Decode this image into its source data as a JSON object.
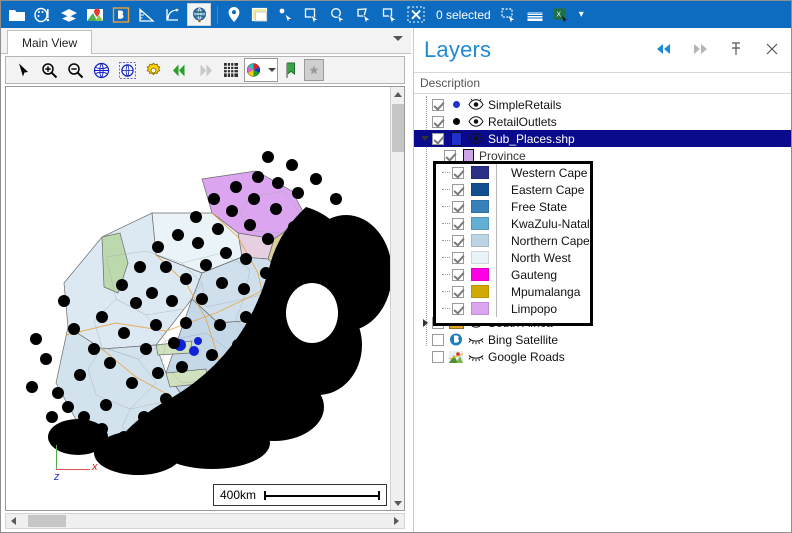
{
  "topbar": {
    "status_text": "0 selected",
    "buttons": [
      {
        "name": "open-folder-icon",
        "label": "Open"
      },
      {
        "name": "symbology-palette-icon",
        "label": "Symbology"
      },
      {
        "name": "layers-stack-icon",
        "label": "Layers"
      },
      {
        "name": "map-pin-image-icon",
        "label": "Add Map"
      },
      {
        "name": "bing-b-icon",
        "label": "Bing"
      },
      {
        "name": "measure-ruler-icon",
        "label": "Measure"
      },
      {
        "name": "coordinate-vector-icon",
        "label": "Coordinates"
      },
      {
        "name": "globe-icon",
        "label": "Globe",
        "active": true
      },
      {
        "name": "location-marker-icon",
        "label": "Identify"
      },
      {
        "name": "map-frame-icon",
        "label": "Map Frame"
      },
      {
        "name": "select-point-icon",
        "label": "Select by Point"
      },
      {
        "name": "select-rectangle-icon",
        "label": "Select by Rectangle"
      },
      {
        "name": "select-circle-icon",
        "label": "Select by Circle"
      },
      {
        "name": "select-polygon-icon",
        "label": "Select by Polygon"
      },
      {
        "name": "select-line-icon",
        "label": "Select by Line"
      },
      {
        "name": "clear-selection-icon",
        "label": "Clear Selection"
      },
      {
        "name": "zoom-to-selection-icon",
        "label": "Zoom to Selection"
      },
      {
        "name": "attribute-table-icon",
        "label": "Attribute Table"
      },
      {
        "name": "export-excel-icon",
        "label": "Export to Excel"
      }
    ],
    "overflow_caret": "▾"
  },
  "tabs": {
    "items": [
      {
        "label": "Main View",
        "active": true
      }
    ],
    "overflow_label": ""
  },
  "map_toolbar": {
    "buttons": [
      {
        "name": "pan-pointer-icon",
        "label": "Pointer"
      },
      {
        "name": "zoom-in-icon",
        "label": "Zoom In"
      },
      {
        "name": "zoom-out-icon",
        "label": "Zoom Out"
      },
      {
        "name": "zoom-full-extent-icon",
        "label": "Full Extent"
      },
      {
        "name": "zoom-layer-extent-icon",
        "label": "Layer Extent"
      },
      {
        "name": "settings-gear-icon",
        "label": "Settings"
      },
      {
        "name": "previous-extent-icon",
        "label": "Previous Extent"
      },
      {
        "name": "next-extent-icon",
        "label": "Next Extent"
      },
      {
        "name": "grid-icon",
        "label": "Grid"
      },
      {
        "name": "color-palette-icon",
        "label": "Color Palette"
      },
      {
        "name": "bookmark-flag-icon",
        "label": "Bookmark"
      },
      {
        "name": "favorite-star-icon",
        "label": "Favorite"
      }
    ]
  },
  "layers_panel": {
    "title": "Layers",
    "column_header": "Description",
    "actions": [
      {
        "name": "collapse-all-icon",
        "label": "Collapse"
      },
      {
        "name": "expand-all-icon",
        "label": "Expand"
      },
      {
        "name": "pin-panel-icon",
        "label": "Pin"
      },
      {
        "name": "close-panel-icon",
        "label": "Close"
      }
    ],
    "tree": [
      {
        "label": "SimpleRetails",
        "checked": true,
        "visible": true,
        "symbol": "point",
        "color": "#2233cc",
        "indent": 1
      },
      {
        "label": "RetailOutlets",
        "checked": true,
        "visible": true,
        "symbol": "point",
        "color": "#000000",
        "indent": 1
      },
      {
        "label": "Sub_Places.shp",
        "checked": true,
        "visible": true,
        "symbol": "polygon",
        "color": "#2030c8",
        "indent": 1,
        "selected": true,
        "expanded": true
      },
      {
        "label": "Province",
        "checked": true,
        "visible": true,
        "symbol": "polygon",
        "color": "#cfa3e8",
        "indent": 2
      },
      {
        "label": "South Africa",
        "checked": false,
        "visible": true,
        "symbol": "folder",
        "indent": 1,
        "expanded": false
      },
      {
        "label": "Bing Satellite",
        "checked": false,
        "visible": false,
        "symbol": "bing",
        "indent": 2
      },
      {
        "label": "Google Roads",
        "checked": false,
        "visible": false,
        "symbol": "google",
        "indent": 2
      }
    ]
  },
  "legend": {
    "field": "Province",
    "items": [
      {
        "label": "Western Cape",
        "color": "#2b2f86",
        "checked": true
      },
      {
        "label": "Eastern Cape",
        "color": "#10508f",
        "checked": true
      },
      {
        "label": "Free State",
        "color": "#3681bb",
        "checked": true
      },
      {
        "label": "KwaZulu-Natal",
        "color": "#63aed3",
        "checked": true
      },
      {
        "label": "Northern Cape",
        "color": "#bcd4e3",
        "checked": true
      },
      {
        "label": "North West",
        "color": "#eaf4f8",
        "checked": true
      },
      {
        "label": "Gauteng",
        "color": "#ff00e5",
        "checked": true
      },
      {
        "label": "Mpumalanga",
        "color": "#d2aa06",
        "checked": true
      },
      {
        "label": "Limpopo",
        "color": "#dba6ef",
        "checked": true
      }
    ]
  },
  "map": {
    "scale_label": "400km",
    "axis": {
      "x_label": "x",
      "z_label": "z"
    },
    "background": "#ffffff"
  }
}
